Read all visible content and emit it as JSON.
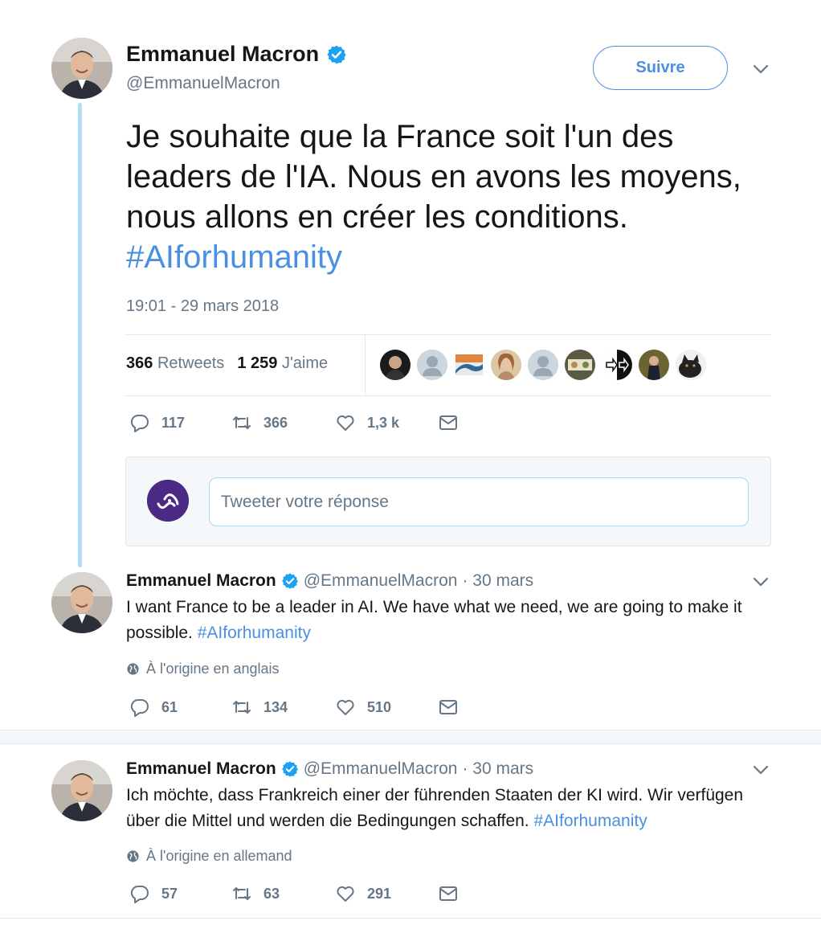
{
  "main_tweet": {
    "author_name": "Emmanuel Macron",
    "author_handle": "@EmmanuelMacron",
    "follow_label": "Suivre",
    "text": "Je souhaite que la France soit l'un des leaders de l'IA. Nous en avons les moyens, nous allons en créer les conditions. ",
    "hashtag": "#AIforhumanity",
    "timestamp": "19:01 - 29 mars 2018",
    "retweets_count": "366",
    "retweets_label": "Retweets",
    "likes_count": "1 259",
    "likes_label": "J'aime",
    "actions": {
      "replies": "117",
      "retweets": "366",
      "likes": "1,3 k"
    }
  },
  "reply_box": {
    "placeholder": "Tweeter votre réponse"
  },
  "replies": [
    {
      "author_name": "Emmanuel Macron",
      "author_handle": "@EmmanuelMacron",
      "date": "· 30 mars",
      "text": "I want France to be a leader in AI. We have what we need, we are going to make it possible. ",
      "hashtag": "#AIforhumanity",
      "translation_note": "À l'origine en anglais",
      "actions": {
        "replies": "61",
        "retweets": "134",
        "likes": "510"
      }
    },
    {
      "author_name": "Emmanuel Macron",
      "author_handle": "@EmmanuelMacron",
      "date": "· 30 mars",
      "text": "Ich möchte, dass Frankreich einer der führenden Staaten der KI wird. Wir verfügen über die Mittel und werden die Bedingungen schaffen. ",
      "hashtag": "#AIforhumanity",
      "translation_note": "À l'origine en allemand",
      "actions": {
        "replies": "57",
        "retweets": "63",
        "likes": "291"
      }
    }
  ],
  "colors": {
    "accent": "#4a90e2",
    "muted": "#657786",
    "thread_line": "#b3dcf6"
  },
  "icons": [
    "verified-badge-icon",
    "chevron-down-icon",
    "reply-icon",
    "retweet-icon",
    "like-icon",
    "message-icon",
    "globe-icon"
  ]
}
